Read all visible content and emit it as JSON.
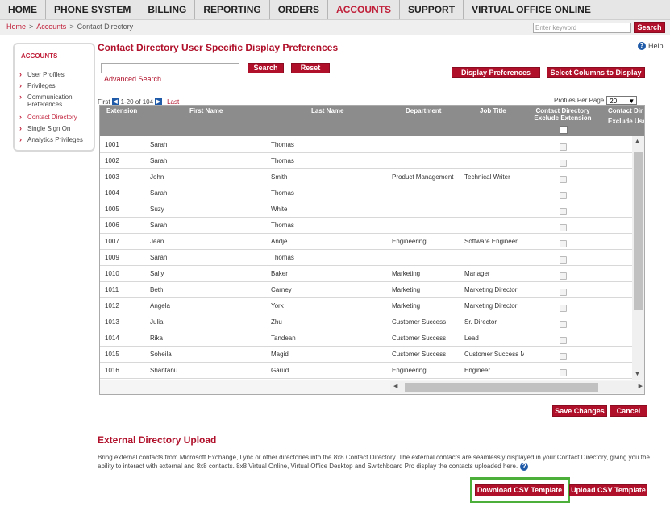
{
  "topnav": [
    {
      "label": "HOME",
      "active": false
    },
    {
      "label": "PHONE SYSTEM",
      "active": false
    },
    {
      "label": "BILLING",
      "active": false
    },
    {
      "label": "REPORTING",
      "active": false
    },
    {
      "label": "ORDERS",
      "active": false
    },
    {
      "label": "ACCOUNTS",
      "active": true
    },
    {
      "label": "SUPPORT",
      "active": false
    },
    {
      "label": "VIRTUAL OFFICE ONLINE",
      "active": false
    }
  ],
  "breadcrumb": {
    "home": "Home",
    "accounts": "Accounts",
    "current": "Contact Directory",
    "sep": ">"
  },
  "keyword": {
    "placeholder": "Enter keyword",
    "button": "Search"
  },
  "sidebar": {
    "title": "ACCOUNTS",
    "items": [
      {
        "label": "User Profiles",
        "active": false
      },
      {
        "label": "Privileges",
        "active": false
      },
      {
        "label": "Communication Preferences",
        "active": false
      },
      {
        "label": "Contact Directory",
        "active": true
      },
      {
        "label": "Single Sign On",
        "active": false
      },
      {
        "label": "Analytics Privileges",
        "active": false
      }
    ]
  },
  "page": {
    "title": "Contact Directory User Specific Display Preferences",
    "help": "Help",
    "search_button": "Search",
    "reset_button": "Reset",
    "advanced_search": "Advanced Search",
    "display_prefs_button": "Display Preferences",
    "select_columns_button": "Select Columns to Display"
  },
  "pager": {
    "first": "First",
    "range": "1-20",
    "of": "of 104",
    "last": "Last",
    "per_page_label": "Profiles Per Page",
    "per_page_value": "20"
  },
  "table": {
    "headers": {
      "extension": "Extension",
      "first_name": "First Name",
      "last_name": "Last Name",
      "department": "Department",
      "job_title": "Job Title",
      "exclude_ext_1": "Contact Directory",
      "exclude_ext_2": "Exclude Extension",
      "exclude_user_1": "Contact Dir",
      "exclude_user_2": "Exclude User P"
    },
    "rows": [
      {
        "ext": "1001",
        "first": "Sarah",
        "last": "Thomas",
        "dept": "",
        "title": ""
      },
      {
        "ext": "1002",
        "first": "Sarah",
        "last": "Thomas",
        "dept": "",
        "title": ""
      },
      {
        "ext": "1003",
        "first": "John",
        "last": "Smith",
        "dept": "Product Management",
        "title": "Technical Writer"
      },
      {
        "ext": "1004",
        "first": "Sarah",
        "last": "Thomas",
        "dept": "",
        "title": ""
      },
      {
        "ext": "1005",
        "first": "Suzy",
        "last": "White",
        "dept": "",
        "title": ""
      },
      {
        "ext": "1006",
        "first": "Sarah",
        "last": "Thomas",
        "dept": "",
        "title": ""
      },
      {
        "ext": "1007",
        "first": "Jean",
        "last": "Andje",
        "dept": "Engineering",
        "title": "Software Engineer"
      },
      {
        "ext": "1009",
        "first": "Sarah",
        "last": "Thomas",
        "dept": "",
        "title": ""
      },
      {
        "ext": "1010",
        "first": "Sally",
        "last": "Baker",
        "dept": "Marketing",
        "title": "Manager"
      },
      {
        "ext": "1011",
        "first": "Beth",
        "last": "Carney",
        "dept": "Marketing",
        "title": "Marketing Director"
      },
      {
        "ext": "1012",
        "first": "Angela",
        "last": "York",
        "dept": "Marketing",
        "title": "Marketing Director"
      },
      {
        "ext": "1013",
        "first": "Julia",
        "last": "Zhu",
        "dept": "Customer Success",
        "title": "Sr. Director"
      },
      {
        "ext": "1014",
        "first": "Rika",
        "last": "Tandean",
        "dept": "Customer Success",
        "title": "Lead"
      },
      {
        "ext": "1015",
        "first": "Soheila",
        "last": "Magidi",
        "dept": "Customer Success",
        "title": "Customer Success M"
      },
      {
        "ext": "1016",
        "first": "Shantanu",
        "last": "Garud",
        "dept": "Engineering",
        "title": "Engineer"
      }
    ]
  },
  "actions": {
    "save": "Save Changes",
    "cancel": "Cancel"
  },
  "upload": {
    "title": "External Directory Upload",
    "description": "Bring external contacts from Microsoft Exchange, Lync or other directories into the 8x8 Contact Directory. The external contacts are seamlessly displayed in your Contact Directory, giving you the ability to interact with external and 8x8 contacts. 8x8 Virtual Online, Virtual Office Desktop and Switchboard Pro display the contacts uploaded here.",
    "download_button": "Download CSV Template",
    "upload_button": "Upload CSV Template"
  },
  "colors": {
    "accent": "#b0102a",
    "highlight": "#4caf3a",
    "header_gray": "#8c8c8c",
    "link_blue": "#1f5aa8"
  }
}
